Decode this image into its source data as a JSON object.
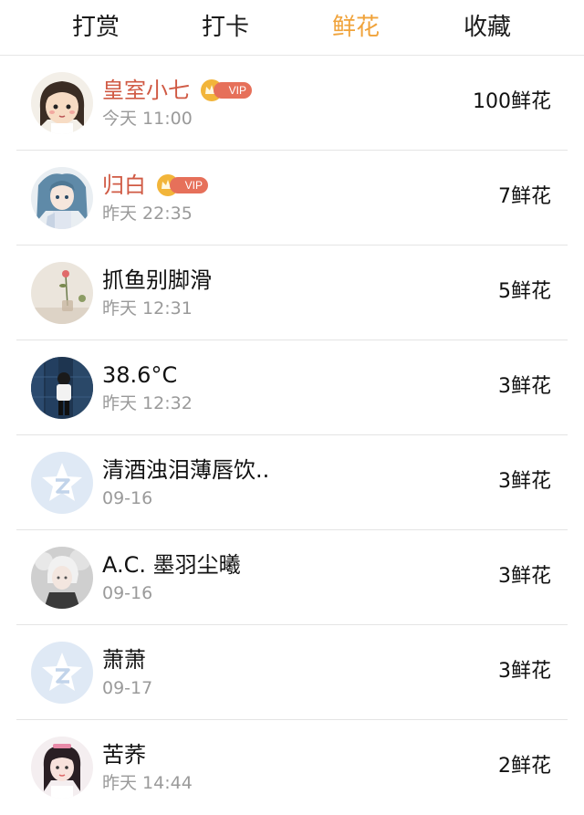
{
  "tabs": [
    {
      "label": "打赏",
      "active": false
    },
    {
      "label": "打卡",
      "active": false
    },
    {
      "label": "鲜花",
      "active": true
    },
    {
      "label": "收藏",
      "active": false
    }
  ],
  "colors": {
    "active_tab": "#f0a33b",
    "vip_name": "#d05a44",
    "vip_badge": "#e6705a",
    "crown": "#f2b53a",
    "time_text": "#9a9a9a"
  },
  "vip_label": "VIP",
  "rows": [
    {
      "name": "皇室小七",
      "vip": true,
      "time": "今天 11:00",
      "flowers": "100鲜花",
      "avatar": "cartoon-girl-avatar"
    },
    {
      "name": "归白",
      "vip": true,
      "time": "昨天 22:35",
      "flowers": "7鲜花",
      "avatar": "anime-character-avatar"
    },
    {
      "name": "抓鱼别脚滑",
      "vip": false,
      "time": "昨天 12:31",
      "flowers": "5鲜花",
      "avatar": "flower-vase-avatar"
    },
    {
      "name": "38.6°C",
      "vip": false,
      "time": "昨天 12:32",
      "flowers": "3鲜花",
      "avatar": "person-photo-avatar"
    },
    {
      "name": "清酒浊泪薄唇饮..",
      "vip": false,
      "time": "09-16",
      "flowers": "3鲜花",
      "avatar": "default-qq-avatar"
    },
    {
      "name": "A.C. 墨羽尘曦",
      "vip": false,
      "time": "09-16",
      "flowers": "3鲜花",
      "avatar": "anime-boy-avatar"
    },
    {
      "name": "萧萧",
      "vip": false,
      "time": "09-17",
      "flowers": "3鲜花",
      "avatar": "default-qq-avatar"
    },
    {
      "name": "苦荞",
      "vip": false,
      "time": "昨天 14:44",
      "flowers": "2鲜花",
      "avatar": "girl-photo-avatar"
    }
  ]
}
